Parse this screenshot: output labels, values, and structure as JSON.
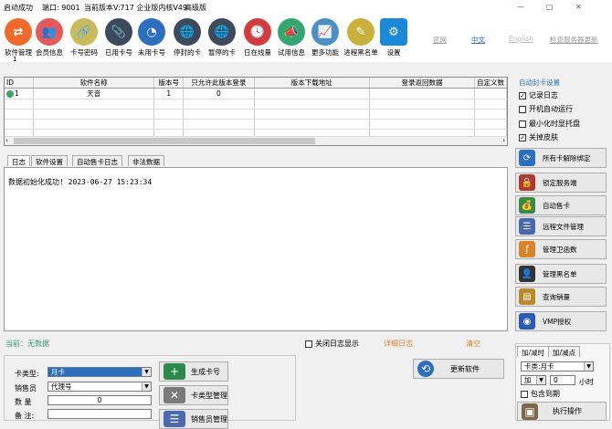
{
  "titlebar": {
    "status": "启动成功",
    "port": "端口: 9001",
    "version": "当前版本V:717 企业版内核V49",
    "edition": "高级版",
    "minimize": "—",
    "maximize": "□",
    "close": "✕"
  },
  "toolbar": {
    "items": [
      {
        "label": "软件管理",
        "icon": "swap-icon",
        "color": "#f06a2c",
        "glyph": "⇄"
      },
      {
        "label": "会员信息",
        "icon": "users-icon",
        "color": "#e85858",
        "glyph": "👥"
      },
      {
        "label": "卡号密码",
        "icon": "link-icon",
        "color": "#c9bc58",
        "glyph": "🔗"
      },
      {
        "label": "已用卡号",
        "icon": "paperclip-icon",
        "color": "#3c4a5c",
        "glyph": "📎"
      },
      {
        "label": "未用卡号",
        "icon": "pie-chart-icon",
        "color": "#2a6fc0",
        "glyph": "◔"
      },
      {
        "label": "停封的卡",
        "icon": "globe-icon",
        "color": "#3c4a5c",
        "glyph": "🌐"
      },
      {
        "label": "暂停的卡",
        "icon": "globe-icon",
        "color": "#3c4a5c",
        "glyph": "🌐"
      },
      {
        "label": "日在线量",
        "icon": "clock-icon",
        "color": "#d63a3a",
        "glyph": "🕓"
      },
      {
        "label": "试用信息",
        "icon": "megaphone-icon",
        "color": "#32a870",
        "glyph": "📣"
      },
      {
        "label": "更多功能",
        "icon": "line-chart-icon",
        "color": "#4a90c8",
        "glyph": "📈"
      },
      {
        "label": "进程黑名单",
        "icon": "notepad-icon",
        "color": "#c8b03a",
        "glyph": "✎"
      },
      {
        "label": "设置",
        "icon": "gear-icon",
        "color": "#1a8ad8",
        "glyph": "⚙"
      }
    ],
    "counter": "1",
    "links": {
      "website": "官网",
      "chinese": "中文",
      "english": "English",
      "check_update": "检查服务器更新"
    }
  },
  "grid": {
    "columns": [
      "ID",
      "软件名称",
      "版本号",
      "只允许此版本登录",
      "版本下载地址",
      "登录返回数据",
      "自定义数"
    ],
    "rows": [
      {
        "id": "1",
        "name": "天音",
        "version": "1",
        "only_version": "0",
        "download": "",
        "login_data": "",
        "custom": ""
      }
    ]
  },
  "tabs": [
    "日志",
    "软件设置",
    "自动售卡日志",
    "非法数据"
  ],
  "log": {
    "entries": [
      "数据初始化成功!  2023-06-27 15:23:34"
    ],
    "status": "当前：无数据",
    "close_log_label": "关闭日志显示",
    "detail_log": "详细日志",
    "clear": "清空"
  },
  "card_form": {
    "card_type_label": "卡类型:",
    "card_type_value": "月卡",
    "seller_label": "销售员",
    "seller_value": "代理号",
    "quantity_label": "数  量",
    "quantity_value": "0",
    "remark_label": "备  注:",
    "remark_value": "",
    "generate_button": "生成卡号",
    "card_type_mgmt": "卡类型管理",
    "seller_mgmt": "销售员管理",
    "update_software": "更新软件"
  },
  "right_panel": {
    "auto_card_title": "自动封卡设置",
    "checkboxes": [
      {
        "label": "记录日志",
        "checked": true
      },
      {
        "label": "开机自动运行",
        "checked": false
      },
      {
        "label": "最小化时显托盘",
        "checked": false
      },
      {
        "label": "关掉皮肤",
        "checked": true
      }
    ],
    "buttons": [
      {
        "label": "所有卡解除绑定",
        "icon": "refresh-icon",
        "color": "#2a6fc0",
        "glyph": "⟳"
      },
      {
        "label": "锁定服务端",
        "icon": "lock-icon",
        "color": "#b03a2e",
        "glyph": "🔒"
      },
      {
        "label": "自动售卡",
        "icon": "money-bag-icon",
        "color": "#3a8a4a",
        "glyph": "💰"
      },
      {
        "label": "远程文件管理",
        "icon": "file-list-icon",
        "color": "#4a6ab0",
        "glyph": "☰"
      },
      {
        "label": "管理卫函数",
        "icon": "function-icon",
        "color": "#d8822a",
        "glyph": "ƒ"
      },
      {
        "label": "管理黑名单",
        "icon": "contact-icon",
        "color": "#333333",
        "glyph": "👤"
      },
      {
        "label": "查询销量",
        "icon": "report-icon",
        "color": "#b88a2a",
        "glyph": "▤"
      },
      {
        "label": "VMP授权",
        "icon": "shield-icon",
        "color": "#2a5ab8",
        "glyph": "◉"
      }
    ],
    "tabs": [
      "加/减时",
      "加/减点"
    ],
    "card_type_label": "卡类:月卡",
    "op_value": "加",
    "hours_value": "0",
    "hours_unit": "小时",
    "include_expired": "包含到期",
    "execute": "执行操作"
  }
}
